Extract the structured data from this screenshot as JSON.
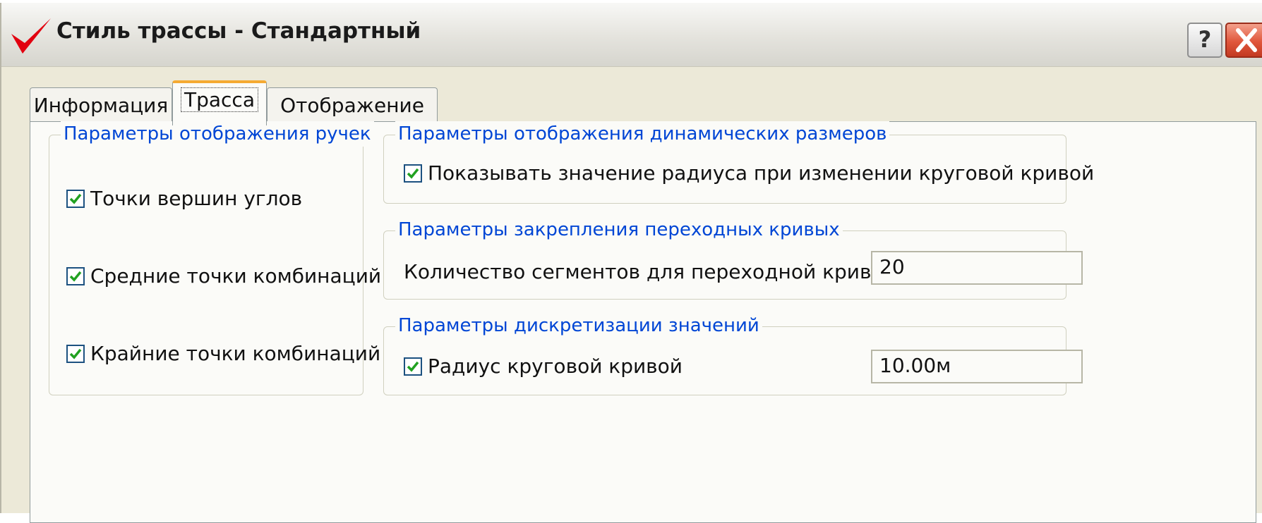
{
  "window": {
    "title": "Стиль трассы - Стандартный",
    "help_label": "?"
  },
  "tabs": [
    {
      "label": "Информация"
    },
    {
      "label": "Трасса",
      "active": true
    },
    {
      "label": "Отображение"
    }
  ],
  "grips": {
    "title": "Параметры отображения ручек",
    "items": [
      {
        "label": "Точки вершин углов",
        "checked": true
      },
      {
        "label": "Средние точки комбинаций",
        "checked": true
      },
      {
        "label": "Крайние точки комбинаций",
        "checked": true
      }
    ]
  },
  "dynamic_dims": {
    "title": "Параметры отображения динамических размеров",
    "option": {
      "label": "Показывать значение радиуса при изменении круговой кривой",
      "checked": true
    }
  },
  "spiral": {
    "title": "Параметры закрепления переходных кривых",
    "label": "Количество сегментов для переходной кривой:",
    "value": "20"
  },
  "discretization": {
    "title": "Параметры дискретизации значений",
    "option": {
      "label": "Радиус круговой кривой",
      "checked": true
    },
    "value": "10.00м"
  },
  "colors": {
    "legend_text": "#0046d5",
    "check_mark": "#21a121",
    "active_tab_accent": "#f5aa32",
    "close_button": "#e0563b"
  },
  "icons": [
    "checkmark-logo-icon",
    "help-icon",
    "close-icon",
    "checkbox-checked-icon"
  ]
}
